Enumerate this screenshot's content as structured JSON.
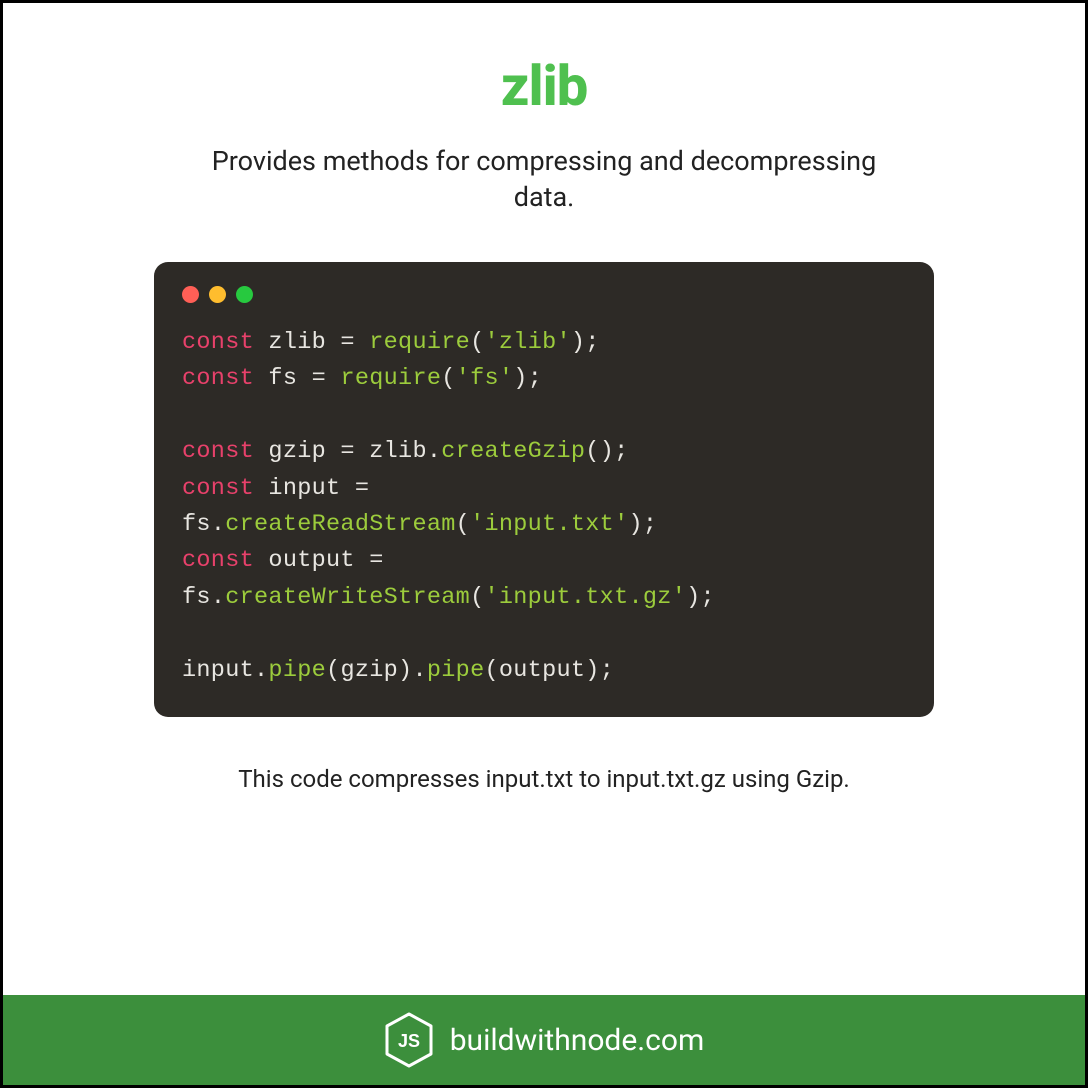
{
  "title": "zlib",
  "subtitle": "Provides methods for compressing and decompressing data.",
  "caption": "This code compresses input.txt to input.txt.gz using Gzip.",
  "footer": {
    "site": "buildwithnode.com"
  },
  "code": {
    "tokens": [
      [
        [
          "kw",
          "const"
        ],
        [
          "punc",
          " "
        ],
        [
          "id",
          "zlib"
        ],
        [
          "punc",
          " = "
        ],
        [
          "fn",
          "require"
        ],
        [
          "punc",
          "("
        ],
        [
          "str",
          "'zlib'"
        ],
        [
          "punc",
          ");"
        ]
      ],
      [
        [
          "kw",
          "const"
        ],
        [
          "punc",
          " "
        ],
        [
          "id",
          "fs"
        ],
        [
          "punc",
          " = "
        ],
        [
          "fn",
          "require"
        ],
        [
          "punc",
          "("
        ],
        [
          "str",
          "'fs'"
        ],
        [
          "punc",
          ");"
        ]
      ],
      [],
      [
        [
          "kw",
          "const"
        ],
        [
          "punc",
          " "
        ],
        [
          "id",
          "gzip"
        ],
        [
          "punc",
          " = "
        ],
        [
          "id",
          "zlib"
        ],
        [
          "punc",
          "."
        ],
        [
          "fn",
          "createGzip"
        ],
        [
          "punc",
          "();"
        ]
      ],
      [
        [
          "kw",
          "const"
        ],
        [
          "punc",
          " "
        ],
        [
          "id",
          "input"
        ],
        [
          "punc",
          " ="
        ]
      ],
      [
        [
          "id",
          "fs"
        ],
        [
          "punc",
          "."
        ],
        [
          "fn",
          "createReadStream"
        ],
        [
          "punc",
          "("
        ],
        [
          "str",
          "'input.txt'"
        ],
        [
          "punc",
          ");"
        ]
      ],
      [
        [
          "kw",
          "const"
        ],
        [
          "punc",
          " "
        ],
        [
          "id",
          "output"
        ],
        [
          "punc",
          " ="
        ]
      ],
      [
        [
          "id",
          "fs"
        ],
        [
          "punc",
          "."
        ],
        [
          "fn",
          "createWriteStream"
        ],
        [
          "punc",
          "("
        ],
        [
          "str",
          "'input.txt.gz'"
        ],
        [
          "punc",
          ");"
        ]
      ],
      [],
      [
        [
          "id",
          "input"
        ],
        [
          "punc",
          "."
        ],
        [
          "fn",
          "pipe"
        ],
        [
          "punc",
          "("
        ],
        [
          "id",
          "gzip"
        ],
        [
          "punc",
          ")."
        ],
        [
          "fn",
          "pipe"
        ],
        [
          "punc",
          "("
        ],
        [
          "id",
          "output"
        ],
        [
          "punc",
          ");"
        ]
      ]
    ]
  }
}
